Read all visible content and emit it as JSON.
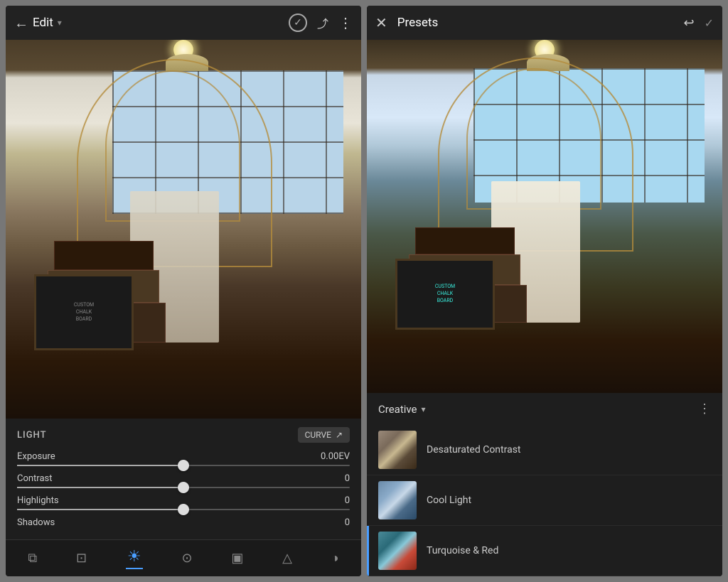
{
  "left_screen": {
    "header": {
      "back_label": "←",
      "title": "Edit",
      "dropdown_arrow": "▾",
      "check_icon": "✓",
      "share_icon": "⋮",
      "more_icon": "⋮"
    },
    "panel": {
      "section_title": "LIGHT",
      "curve_btn_label": "CURVE",
      "curve_icon": "↗",
      "sliders": [
        {
          "label": "Exposure",
          "value": "0.00EV",
          "percent": 50
        },
        {
          "label": "Contrast",
          "value": "0",
          "percent": 50
        },
        {
          "label": "Highlights",
          "value": "0",
          "percent": 50
        },
        {
          "label": "Shadows",
          "value": "0",
          "percent": 50
        }
      ]
    },
    "toolbar": {
      "items": [
        {
          "icon": "⧉",
          "name": "layers-icon",
          "active": false
        },
        {
          "icon": "⊞",
          "name": "crop-icon",
          "active": false
        },
        {
          "icon": "☀",
          "name": "light-icon",
          "active": true
        },
        {
          "icon": "⊙",
          "name": "temp-icon",
          "active": false
        },
        {
          "icon": "▣",
          "name": "detail-icon",
          "active": false
        },
        {
          "icon": "△",
          "name": "tone-icon",
          "active": false
        },
        {
          "icon": "◑",
          "name": "hsl-icon",
          "active": false
        }
      ]
    }
  },
  "right_screen": {
    "header": {
      "close_label": "✕",
      "title": "Presets",
      "undo_icon": "↩",
      "check_icon": "✓"
    },
    "category": {
      "label": "Creative",
      "chevron": "▾"
    },
    "more_icon": "⋮",
    "presets": [
      {
        "name": "Desaturated Contrast",
        "thumb_class": "thumb-desat",
        "active": false
      },
      {
        "name": "Cool Light",
        "thumb_class": "thumb-cool",
        "active": false
      },
      {
        "name": "Turquoise & Red",
        "thumb_class": "thumb-turq",
        "active": true
      }
    ]
  },
  "colors": {
    "accent_blue": "#4a9eff",
    "bg_dark": "#1e1e1e",
    "text_light": "#ccc",
    "text_muted": "#888"
  }
}
